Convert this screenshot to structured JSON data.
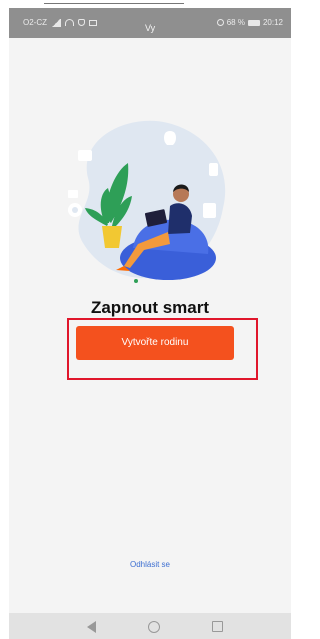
{
  "status_bar": {
    "carrier": "O2-CZ",
    "center_label": "Vy",
    "battery": "68 %",
    "time": "20:12"
  },
  "main": {
    "title": "Zapnout smart",
    "create_button_label": "Vytvořte rodinu",
    "logout_label": "Odhlásit se"
  },
  "colors": {
    "accent": "#f4511e",
    "highlight": "#e0162b",
    "link": "#3d6fd1"
  },
  "icons": [
    "signal-icon",
    "wifi-icon",
    "shield-icon",
    "mail-icon",
    "alarm-icon",
    "battery-icon",
    "back-icon",
    "home-icon",
    "recent-apps-icon"
  ]
}
